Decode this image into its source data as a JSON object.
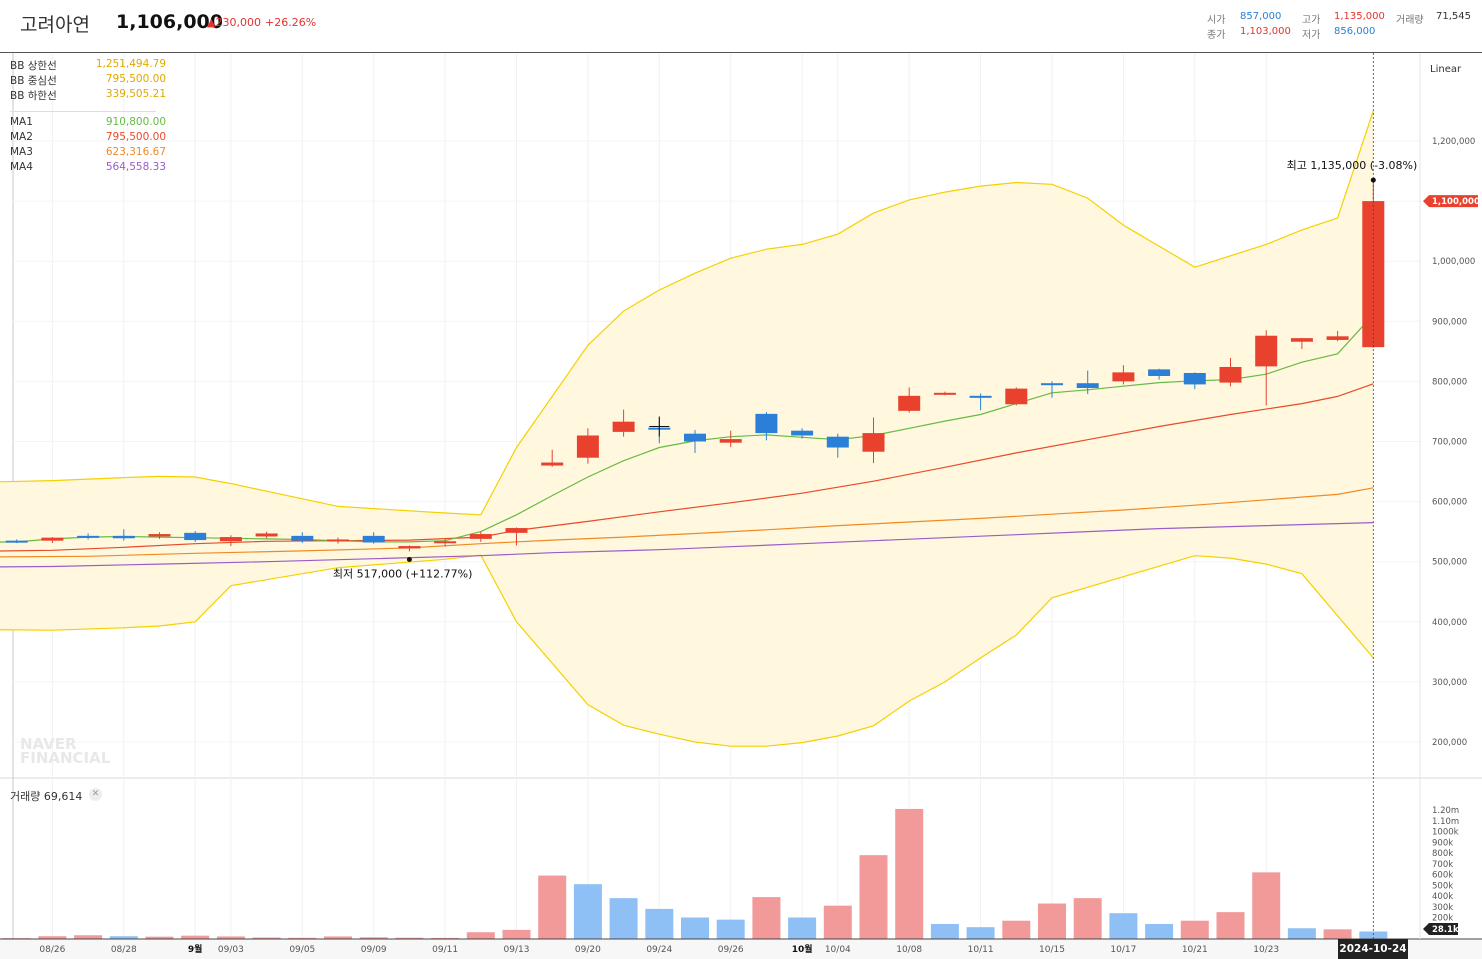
{
  "header": {
    "stock_name": "고려아연",
    "price": "1,106,000",
    "change": "▲230,000",
    "change_rate": "+26.26%",
    "quote": {
      "open_label": "시가",
      "open": "857,000",
      "high_label": "고가",
      "high": "1,135,000",
      "volume_label": "거래량",
      "volume": "71,545",
      "close_label": "종가",
      "close": "1,103,000",
      "low_label": "저가",
      "low": "856,000"
    }
  },
  "legend": {
    "bb_upper_label": "BB 상한선",
    "bb_upper": "1,251,494.79",
    "bb_mid_label": "BB 중심선",
    "bb_mid": "795,500.00",
    "bb_lower_label": "BB 하한선",
    "bb_lower": "339,505.21",
    "ma1_label": "MA1",
    "ma1": "910,800.00",
    "ma2_label": "MA2",
    "ma2": "795,500.00",
    "ma3_label": "MA3",
    "ma3": "623,316.67",
    "ma4_label": "MA4",
    "ma4": "564,558.33"
  },
  "scale_mode": "Linear",
  "volume_panel": {
    "label": "거래량 69,614",
    "close_icon": "close-icon",
    "last_tag": "28.1k"
  },
  "watermark": [
    "NAVER",
    "FINANCIAL"
  ],
  "crosshair_date": "2024-10-24",
  "current_price_tag": "1,100,000",
  "colors": {
    "up": "#e8422f",
    "down": "#2b7fd6",
    "bb": "#f5d000",
    "bb_fill": "#fff8de",
    "ma1": "#66bb44",
    "ma2": "#e84a2a",
    "ma3": "#f08a24",
    "ma4": "#9a5cc8"
  },
  "chart_data": {
    "type": "candlestick",
    "price_axis": {
      "ticks": [
        "200,000",
        "300,000",
        "400,000",
        "500,000",
        "600,000",
        "700,000",
        "800,000",
        "900,000",
        "1,000,000",
        "1,100,000",
        "1,200,000"
      ],
      "range": [
        143000,
        1260000
      ]
    },
    "volume_axis": {
      "ticks": [
        "200k",
        "300k",
        "400k",
        "500k",
        "600k",
        "700k",
        "800k",
        "900k",
        "1000k",
        "1.10m",
        "1.20m"
      ],
      "range": [
        0,
        1220000
      ]
    },
    "x_labels": [
      {
        "i": 1,
        "t": "08/26"
      },
      {
        "i": 3,
        "t": "08/28"
      },
      {
        "i": 5,
        "t": "9월"
      },
      {
        "i": 6,
        "t": "09/03"
      },
      {
        "i": 8,
        "t": "09/05"
      },
      {
        "i": 10,
        "t": "09/09"
      },
      {
        "i": 12,
        "t": "09/11"
      },
      {
        "i": 14,
        "t": "09/13"
      },
      {
        "i": 16,
        "t": "09/20"
      },
      {
        "i": 18,
        "t": "09/24"
      },
      {
        "i": 20,
        "t": "09/26"
      },
      {
        "i": 22,
        "t": "10월"
      },
      {
        "i": 23,
        "t": "10/04"
      },
      {
        "i": 25,
        "t": "10/08"
      },
      {
        "i": 27,
        "t": "10/11"
      },
      {
        "i": 29,
        "t": "10/15"
      },
      {
        "i": 31,
        "t": "10/17"
      },
      {
        "i": 33,
        "t": "10/21"
      },
      {
        "i": 35,
        "t": "10/23"
      }
    ],
    "candles": [
      {
        "o": 535000,
        "h": 537000,
        "l": 531000,
        "c": 534000
      },
      {
        "o": 535000,
        "h": 541000,
        "l": 531000,
        "c": 540000
      },
      {
        "o": 543000,
        "h": 547000,
        "l": 537000,
        "c": 542000
      },
      {
        "o": 543000,
        "h": 554000,
        "l": 535000,
        "c": 539000
      },
      {
        "o": 542000,
        "h": 549000,
        "l": 538000,
        "c": 546000
      },
      {
        "o": 548000,
        "h": 551000,
        "l": 533000,
        "c": 536000
      },
      {
        "o": 534000,
        "h": 544000,
        "l": 526000,
        "c": 541000
      },
      {
        "o": 542000,
        "h": 550000,
        "l": 539000,
        "c": 547000
      },
      {
        "o": 543000,
        "h": 549000,
        "l": 531000,
        "c": 535000
      },
      {
        "o": 537000,
        "h": 540000,
        "l": 530000,
        "c": 537000
      },
      {
        "o": 543000,
        "h": 549000,
        "l": 530000,
        "c": 532000
      },
      {
        "o": 522000,
        "h": 527000,
        "l": 517000,
        "c": 526000
      },
      {
        "o": 533000,
        "h": 538000,
        "l": 525000,
        "c": 534000
      },
      {
        "o": 538000,
        "h": 550000,
        "l": 533000,
        "c": 546000
      },
      {
        "o": 548000,
        "h": 557000,
        "l": 527000,
        "c": 556000
      },
      {
        "o": 660000,
        "h": 686000,
        "l": 658000,
        "c": 665000
      },
      {
        "o": 673000,
        "h": 722000,
        "l": 663000,
        "c": 710000
      },
      {
        "o": 716000,
        "h": 753000,
        "l": 708000,
        "c": 733000
      },
      {
        "o": 723000,
        "h": 740000,
        "l": 697000,
        "c": 722000
      },
      {
        "o": 713000,
        "h": 719000,
        "l": 681000,
        "c": 700000
      },
      {
        "o": 698000,
        "h": 718000,
        "l": 691000,
        "c": 704000
      },
      {
        "o": 746000,
        "h": 749000,
        "l": 702000,
        "c": 714000
      },
      {
        "o": 718000,
        "h": 722000,
        "l": 705000,
        "c": 710000
      },
      {
        "o": 708000,
        "h": 713000,
        "l": 673000,
        "c": 690000
      },
      {
        "o": 683000,
        "h": 740000,
        "l": 664000,
        "c": 714000
      },
      {
        "o": 751000,
        "h": 790000,
        "l": 748000,
        "c": 776000
      },
      {
        "o": 778000,
        "h": 783000,
        "l": 777000,
        "c": 781000
      },
      {
        "o": 776000,
        "h": 780000,
        "l": 752000,
        "c": 775000
      },
      {
        "o": 762000,
        "h": 790000,
        "l": 760000,
        "c": 788000
      },
      {
        "o": 797000,
        "h": 800000,
        "l": 773000,
        "c": 794000
      },
      {
        "o": 797000,
        "h": 818000,
        "l": 779000,
        "c": 789000
      },
      {
        "o": 800000,
        "h": 827000,
        "l": 795000,
        "c": 815000
      },
      {
        "o": 820000,
        "h": 821000,
        "l": 803000,
        "c": 809000
      },
      {
        "o": 814000,
        "h": 815000,
        "l": 787000,
        "c": 795000
      },
      {
        "o": 798000,
        "h": 839000,
        "l": 792000,
        "c": 824000
      },
      {
        "o": 825000,
        "h": 885000,
        "l": 760000,
        "c": 876000
      },
      {
        "o": 866000,
        "h": 872000,
        "l": 854000,
        "c": 872000
      },
      {
        "o": 869000,
        "h": 884000,
        "l": 867000,
        "c": 875000
      },
      {
        "o": 857000,
        "h": 1135000,
        "l": 856000,
        "c": 1100000
      }
    ],
    "volumes": [
      {
        "v": 8000,
        "up": true
      },
      {
        "v": 26000,
        "up": true
      },
      {
        "v": 35000,
        "up": true
      },
      {
        "v": 26000,
        "up": false
      },
      {
        "v": 22000,
        "up": true
      },
      {
        "v": 31000,
        "up": true
      },
      {
        "v": 24000,
        "up": true
      },
      {
        "v": 14000,
        "up": true
      },
      {
        "v": 11000,
        "up": true
      },
      {
        "v": 24000,
        "up": true
      },
      {
        "v": 16000,
        "up": true
      },
      {
        "v": 12000,
        "up": true
      },
      {
        "v": 10000,
        "up": true
      },
      {
        "v": 63000,
        "up": true
      },
      {
        "v": 85000,
        "up": true
      },
      {
        "v": 590000,
        "up": true
      },
      {
        "v": 510000,
        "up": false
      },
      {
        "v": 380000,
        "up": false
      },
      {
        "v": 280000,
        "up": false
      },
      {
        "v": 200000,
        "up": false
      },
      {
        "v": 180000,
        "up": false
      },
      {
        "v": 390000,
        "up": true
      },
      {
        "v": 200000,
        "up": false
      },
      {
        "v": 310000,
        "up": true
      },
      {
        "v": 780000,
        "up": true
      },
      {
        "v": 1210000,
        "up": true
      },
      {
        "v": 140000,
        "up": false
      },
      {
        "v": 110000,
        "up": false
      },
      {
        "v": 170000,
        "up": true
      },
      {
        "v": 330000,
        "up": true
      },
      {
        "v": 380000,
        "up": true
      },
      {
        "v": 240000,
        "up": false
      },
      {
        "v": 140000,
        "up": false
      },
      {
        "v": 170000,
        "up": true
      },
      {
        "v": 250000,
        "up": true
      },
      {
        "v": 620000,
        "up": true
      },
      {
        "v": 100000,
        "up": false
      },
      {
        "v": 90000,
        "up": true
      },
      {
        "v": 69614,
        "up": false
      }
    ],
    "bb_upper": [
      617000,
      635000,
      640000,
      642000,
      641000,
      630000,
      592000,
      581000,
      578000,
      690000,
      860000,
      917000,
      952000,
      980000,
      1005000,
      1020000,
      1028000,
      1045000,
      1080000,
      1102000,
      1115000,
      1125000,
      1131000,
      1128000,
      1105000,
      1060000,
      990000,
      1028000,
      1052000,
      1072000,
      1250000
    ],
    "bb_lower": [
      393000,
      386000,
      390000,
      393000,
      400000,
      460000,
      490000,
      504000,
      511000,
      400000,
      262000,
      228000,
      213000,
      200000,
      193000,
      193000,
      199000,
      210000,
      227000,
      268000,
      300000,
      340000,
      378000,
      440000,
      510000,
      506000,
      496000,
      480000,
      340000
    ],
    "bb_upper_x": [
      -12,
      1,
      3,
      4,
      5,
      6,
      9,
      12,
      13,
      14,
      16,
      17,
      18,
      19,
      20,
      21,
      22,
      23,
      24,
      25,
      26,
      27,
      28,
      29,
      30,
      31,
      33,
      35,
      36,
      37,
      38
    ],
    "bb_lower_x": [
      -12,
      1,
      3,
      4,
      5,
      6,
      9,
      12,
      13,
      14,
      16,
      17,
      18,
      19,
      20,
      21,
      22,
      23,
      24,
      25,
      26,
      27,
      28,
      29,
      33,
      34,
      35,
      36,
      38
    ],
    "ma1": [
      531000,
      533000,
      538000,
      541000,
      542000,
      541000,
      540000,
      539000,
      538000,
      537000,
      535000,
      533000,
      533000,
      535000,
      550000,
      578000,
      610000,
      641000,
      668000,
      690000,
      701000,
      708000,
      711000,
      707000,
      703000,
      710000,
      722000,
      734000,
      745000,
      763000,
      781000,
      786000,
      792000,
      798000,
      801000,
      803000,
      812000,
      832000,
      846000,
      911000
    ],
    "ma1_x": [
      -8,
      0,
      1,
      2,
      3,
      4,
      5,
      6,
      7,
      8,
      9,
      10,
      11,
      12,
      13,
      14,
      15,
      16,
      17,
      18,
      19,
      20,
      21,
      22,
      23,
      24,
      25,
      26,
      27,
      28,
      29,
      30,
      31,
      32,
      33,
      34,
      35,
      36,
      37,
      38
    ],
    "ma2": [
      512000,
      519000,
      524000,
      530000,
      534000,
      535000,
      536000,
      541000,
      552000,
      567000,
      583000,
      598000,
      614000,
      634000,
      657000,
      681000,
      703000,
      725000,
      745000,
      763000,
      775000,
      796000
    ],
    "ma2_x": [
      -8,
      1,
      3,
      5,
      7,
      9,
      11,
      13,
      14,
      16,
      18,
      20,
      22,
      24,
      26,
      28,
      30,
      32,
      34,
      36,
      37,
      38
    ],
    "ma3": [
      505000,
      509000,
      514000,
      518000,
      523000,
      530000,
      536000,
      541000,
      547000,
      553000,
      560000,
      566000,
      572000,
      579000,
      586000,
      594000,
      603000,
      612000,
      623000
    ],
    "ma3_x": [
      -8,
      2,
      5,
      8,
      11,
      13,
      15,
      17,
      19,
      21,
      23,
      25,
      27,
      29,
      31,
      33,
      35,
      37,
      38
    ],
    "ma4": [
      488000,
      492000,
      496000,
      500000,
      505000,
      510000,
      515000,
      520000,
      525000,
      530000,
      535000,
      540000,
      545000,
      550000,
      555000,
      560000,
      565000
    ],
    "ma4_x": [
      -8,
      1,
      4,
      7,
      10,
      13,
      15,
      18,
      20,
      22,
      24,
      26,
      28,
      30,
      32,
      35,
      38
    ],
    "annotations": {
      "high": "최고 1,135,000 (-3.08%)",
      "low": "최저 517,000 (+112.77%)",
      "high_i": 38,
      "high_value": 1135000,
      "low_i": 11,
      "low_value": 517000
    },
    "grid": true
  }
}
